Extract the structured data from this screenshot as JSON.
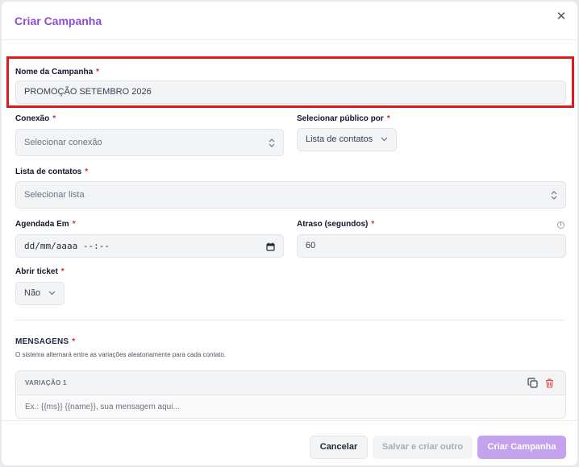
{
  "colors": {
    "accent": "#8d4fcf",
    "accent_light": "#c4a2ee",
    "required": "#dc2626",
    "highlight": "#dc1c1c",
    "delete": "#ef4444"
  },
  "modal": {
    "title": "Criar Campanha",
    "close_icon": "x-icon"
  },
  "form": {
    "campaign_name": {
      "label": "Nome da Campanha",
      "required": "*",
      "value": "PROMOÇÃO SETEMBRO 2026"
    },
    "connection": {
      "label": "Conexão",
      "required": "*",
      "placeholder": "Selecionar conexão"
    },
    "audience": {
      "label": "Selecionar público por",
      "required": "*",
      "value": "Lista de contatos"
    },
    "contact_list": {
      "label": "Lista de contatos",
      "required": "*",
      "placeholder": "Selecionar lista"
    },
    "scheduled_at": {
      "label": "Agendada Em",
      "required": "*",
      "value": "dd/mm/aaaa --:--"
    },
    "delay": {
      "label": "Atraso (segundos)",
      "required": "*",
      "value": "60",
      "info_icon": "info-icon"
    },
    "open_ticket": {
      "label": "Abrir ticket",
      "required": "*",
      "value": "Não"
    }
  },
  "messages": {
    "title": "MENSAGENS",
    "required": "*",
    "subtitle": "O sistema alternará entre as variações aleatoriamente para cada contato.",
    "variations": [
      {
        "label": "VARIAÇÃO 1",
        "placeholder": "Ex.: {{ms}} {{name}}, sua mensagem aqui..."
      }
    ]
  },
  "footer": {
    "cancel_label": "Cancelar",
    "save_other_label": "Salvar e criar outro",
    "create_label": "Criar Campanha"
  }
}
